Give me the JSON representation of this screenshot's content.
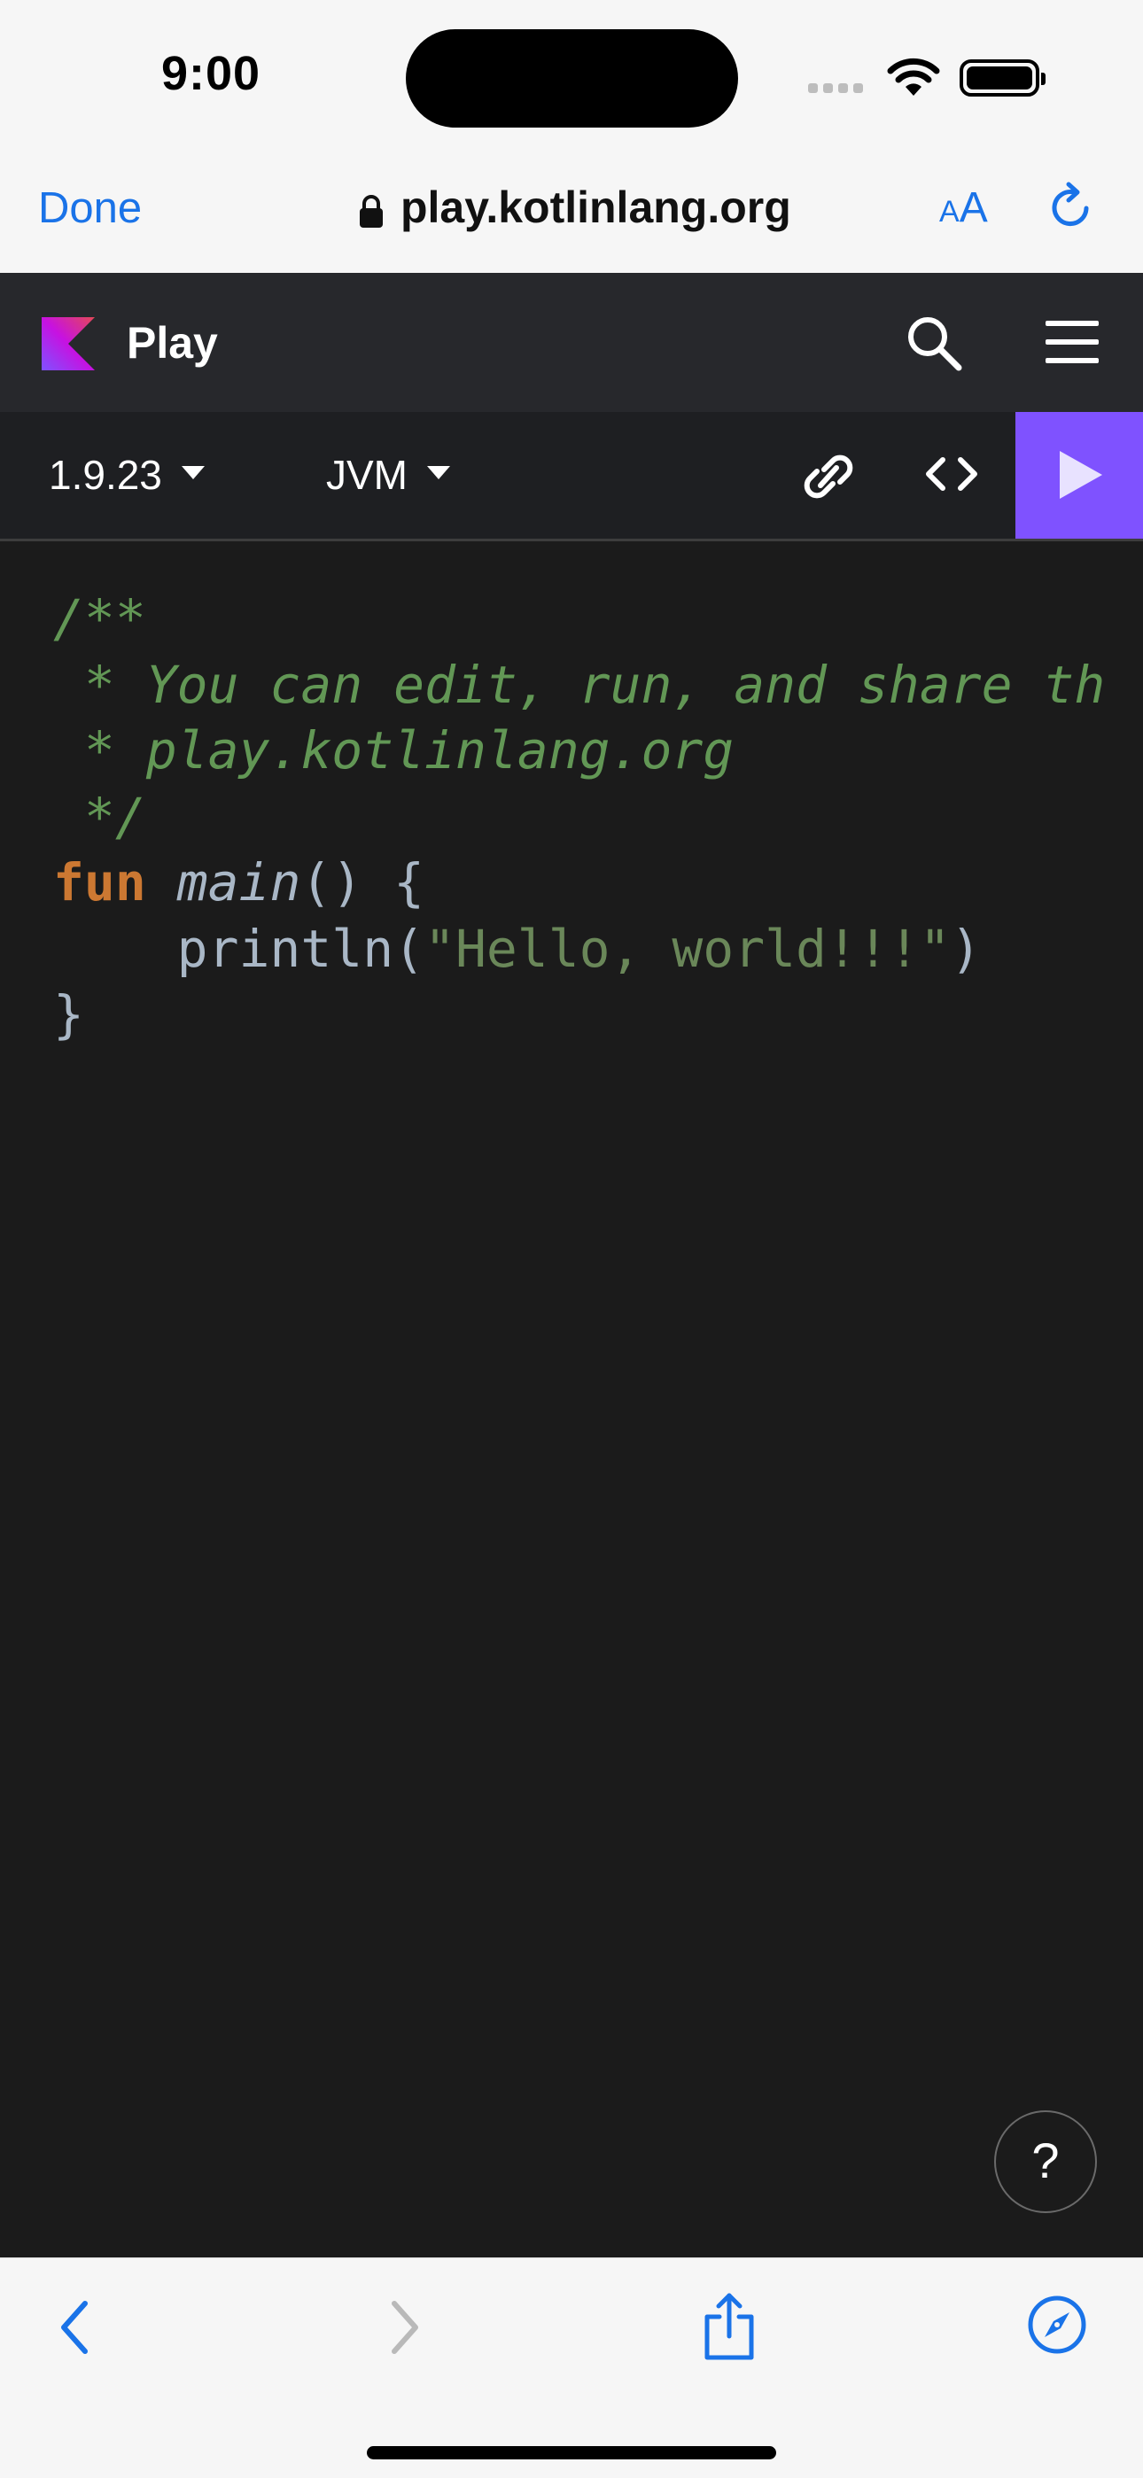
{
  "status_bar": {
    "time": "9:00"
  },
  "browser": {
    "done_label": "Done",
    "url": "play.kotlinlang.org",
    "text_size_label_small": "A",
    "text_size_label_large": "A"
  },
  "header": {
    "title": "Play"
  },
  "toolbar": {
    "version": "1.9.23",
    "target": "JVM"
  },
  "editor": {
    "lines": [
      "/**",
      " * You can edit, run, and share th",
      " * play.kotlinlang.org",
      " */",
      "fun",
      "main",
      "() {",
      "    println(",
      "\"Hello, world!!!\"",
      ")",
      "}"
    ]
  },
  "help_button": {
    "label": "?"
  },
  "colors": {
    "accent": "#7f52ff",
    "link_blue": "#1a73e8",
    "comment_green": "#629755",
    "keyword_orange": "#cc7832",
    "string_green": "#6a8759"
  },
  "icons": {
    "lock": "lock-icon",
    "reload": "reload-icon",
    "search": "search-icon",
    "menu": "hamburger-menu-icon",
    "link": "link-icon",
    "code": "code-brackets-icon",
    "run": "play-icon",
    "back": "chevron-left-icon",
    "forward": "chevron-right-icon",
    "share": "share-icon",
    "compass": "compass-icon"
  }
}
